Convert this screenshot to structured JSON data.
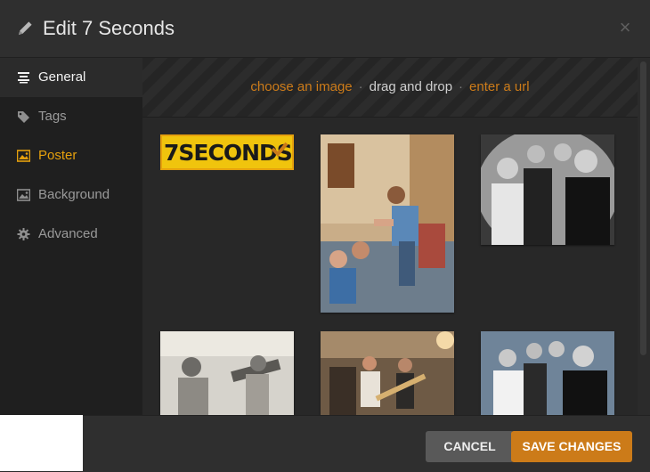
{
  "header": {
    "title": "Edit 7 Seconds",
    "close_glyph": "×"
  },
  "sidebar": {
    "items": [
      {
        "label": "General",
        "icon": "align-lines-icon",
        "active": true
      },
      {
        "label": "Tags",
        "icon": "tag-icon"
      },
      {
        "label": "Poster",
        "icon": "image-icon"
      },
      {
        "label": "Background",
        "icon": "image-icon"
      },
      {
        "label": "Advanced",
        "icon": "gear-icon"
      }
    ]
  },
  "upload": {
    "choose": "choose an image",
    "sep1": "·",
    "drag": "drag and drop",
    "sep2": "·",
    "url": "enter a url"
  },
  "posters": {
    "logo_text": "7SECONDS",
    "selected_index": 0
  },
  "footer": {
    "cancel_label": "CANCEL",
    "save_label": "SAVE CHANGES"
  },
  "colors": {
    "accent": "#e5a00d",
    "accent_dark": "#cc7b19",
    "sidebar_bg": "#1f1f1f",
    "main_bg": "#282828"
  }
}
